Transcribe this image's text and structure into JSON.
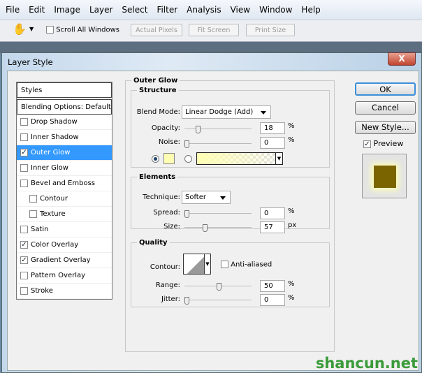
{
  "menu": [
    "File",
    "Edit",
    "Image",
    "Layer",
    "Select",
    "Filter",
    "Analysis",
    "View",
    "Window",
    "Help"
  ],
  "toolbar": {
    "scroll_all": "Scroll All Windows",
    "actual_pixels": "Actual Pixels",
    "fit_screen": "Fit Screen",
    "print_size": "Print Size"
  },
  "dialog": {
    "title": "Layer Style",
    "close": "X"
  },
  "styles": {
    "header": "Styles",
    "blending": "Blending Options: Default",
    "items": [
      {
        "label": "Drop Shadow",
        "checked": false
      },
      {
        "label": "Inner Shadow",
        "checked": false
      },
      {
        "label": "Outer Glow",
        "checked": true
      },
      {
        "label": "Inner Glow",
        "checked": false
      },
      {
        "label": "Bevel and Emboss",
        "checked": false
      },
      {
        "label": "Contour",
        "checked": false
      },
      {
        "label": "Texture",
        "checked": false
      },
      {
        "label": "Satin",
        "checked": false
      },
      {
        "label": "Color Overlay",
        "checked": true
      },
      {
        "label": "Gradient Overlay",
        "checked": true
      },
      {
        "label": "Pattern Overlay",
        "checked": false
      },
      {
        "label": "Stroke",
        "checked": false
      }
    ]
  },
  "panel": {
    "title": "Outer Glow",
    "structure": {
      "title": "Structure",
      "blend_label": "Blend Mode:",
      "blend": "Linear Dodge (Add)",
      "opacity_label": "Opacity:",
      "opacity": "18",
      "noise_label": "Noise:",
      "noise": "0",
      "pct": "%",
      "glow_color": "#ffffb4"
    },
    "elements": {
      "title": "Elements",
      "technique_label": "Technique:",
      "technique": "Softer",
      "spread_label": "Spread:",
      "spread": "0",
      "size_label": "Size:",
      "size": "57",
      "pct": "%",
      "px": "px"
    },
    "quality": {
      "title": "Quality",
      "contour_label": "Contour:",
      "anti": "Anti-aliased",
      "range_label": "Range:",
      "range": "50",
      "jitter_label": "Jitter:",
      "jitter": "0",
      "pct": "%"
    }
  },
  "buttons": {
    "ok": "OK",
    "cancel": "Cancel",
    "new_style": "New Style...",
    "preview": "Preview"
  },
  "preview_color": "#7a6400",
  "watermark": "shancun.net"
}
